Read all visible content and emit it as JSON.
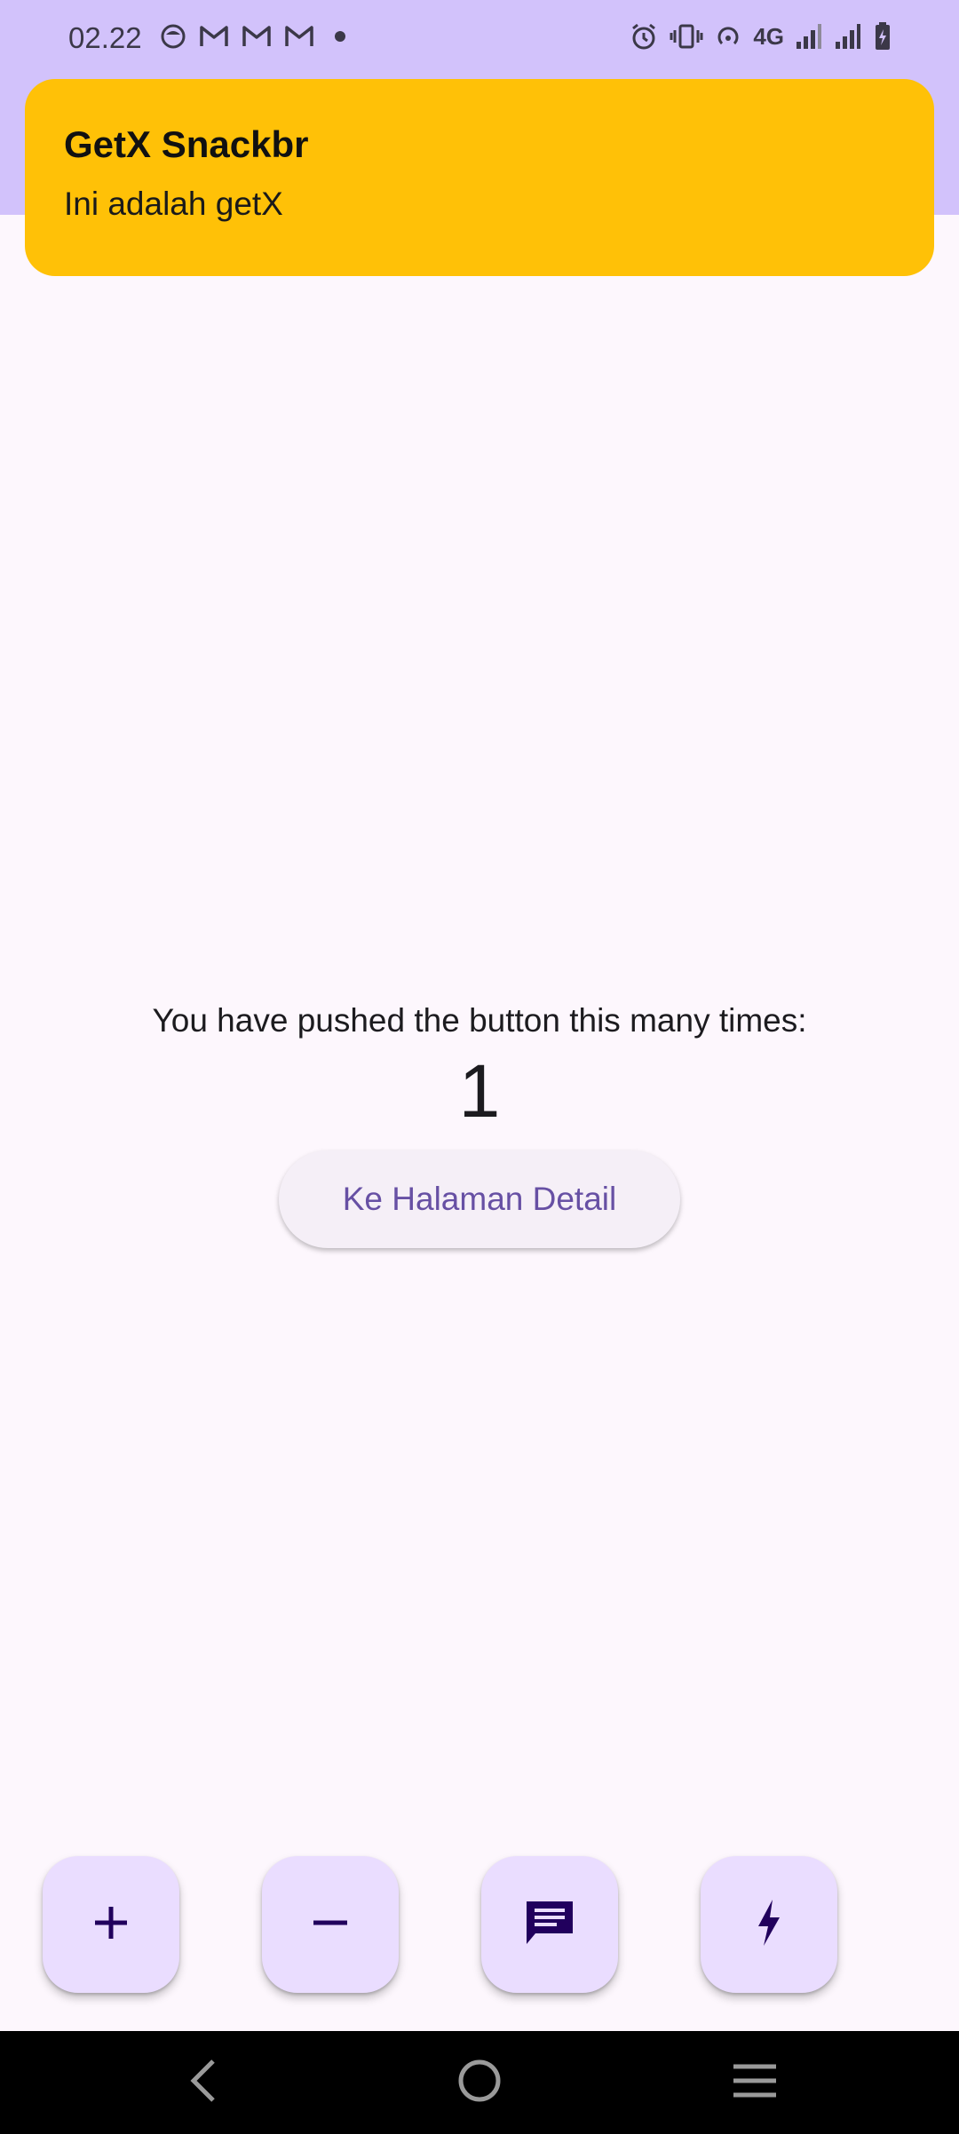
{
  "status_bar": {
    "time": "02.22",
    "notification_icons": [
      "app-icon",
      "gmail-icon",
      "gmail-icon",
      "gmail-icon",
      "dot-icon"
    ],
    "system_icons": [
      "alarm-icon",
      "vibrate-icon",
      "hotspot-icon",
      "4g-icon",
      "signal-icon",
      "signal-icon",
      "battery-charging-icon"
    ],
    "network_label": "4G"
  },
  "snackbar": {
    "title": "GetX Snackbr",
    "message": "Ini adalah getX",
    "color": "#ffc107"
  },
  "main": {
    "pushed_text": "You have pushed the button this many times:",
    "counter": "1",
    "detail_button_label": "Ke Halaman Detail"
  },
  "fabs": [
    {
      "icon": "plus-icon"
    },
    {
      "icon": "minus-icon"
    },
    {
      "icon": "message-icon"
    },
    {
      "icon": "flash-icon"
    }
  ],
  "nav_bar": {
    "buttons": [
      "back-icon",
      "home-icon",
      "menu-icon"
    ]
  },
  "colors": {
    "app_bar": "#d2c2fb",
    "background": "#fdf7fd",
    "fab": "#eaddff",
    "primary_text": "#6750a4",
    "fab_icon": "#21005d"
  }
}
